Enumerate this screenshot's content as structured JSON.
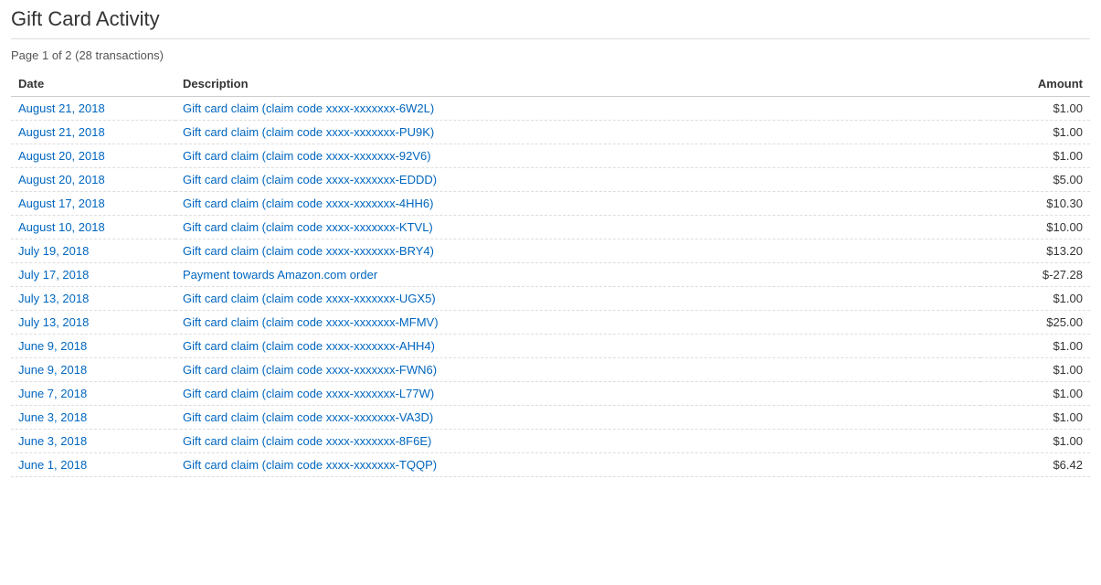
{
  "page": {
    "title": "Gift Card Activity",
    "pagination": "Page 1 of 2 (28 transactions)"
  },
  "table": {
    "headers": {
      "date": "Date",
      "description": "Description",
      "amount": "Amount"
    },
    "rows": [
      {
        "date": "August 21, 2018",
        "description": "Gift card claim (claim code xxxx-xxxxxxx-6W2L)",
        "amount": "$1.00"
      },
      {
        "date": "August 21, 2018",
        "description": "Gift card claim (claim code xxxx-xxxxxxx-PU9K)",
        "amount": "$1.00"
      },
      {
        "date": "August 20, 2018",
        "description": "Gift card claim (claim code xxxx-xxxxxxx-92V6)",
        "amount": "$1.00"
      },
      {
        "date": "August 20, 2018",
        "description": "Gift card claim (claim code xxxx-xxxxxxx-EDDD)",
        "amount": "$5.00"
      },
      {
        "date": "August 17, 2018",
        "description": "Gift card claim (claim code xxxx-xxxxxxx-4HH6)",
        "amount": "$10.30"
      },
      {
        "date": "August 10, 2018",
        "description": "Gift card claim (claim code xxxx-xxxxxxx-KTVL)",
        "amount": "$10.00"
      },
      {
        "date": "July 19, 2018",
        "description": "Gift card claim (claim code xxxx-xxxxxxx-BRY4)",
        "amount": "$13.20"
      },
      {
        "date": "July 17, 2018",
        "description": "Payment towards Amazon.com order",
        "amount": "$-27.28"
      },
      {
        "date": "July 13, 2018",
        "description": "Gift card claim (claim code xxxx-xxxxxxx-UGX5)",
        "amount": "$1.00"
      },
      {
        "date": "July 13, 2018",
        "description": "Gift card claim (claim code xxxx-xxxxxxx-MFMV)",
        "amount": "$25.00"
      },
      {
        "date": "June 9, 2018",
        "description": "Gift card claim (claim code xxxx-xxxxxxx-AHH4)",
        "amount": "$1.00"
      },
      {
        "date": "June 9, 2018",
        "description": "Gift card claim (claim code xxxx-xxxxxxx-FWN6)",
        "amount": "$1.00"
      },
      {
        "date": "June 7, 2018",
        "description": "Gift card claim (claim code xxxx-xxxxxxx-L77W)",
        "amount": "$1.00"
      },
      {
        "date": "June 3, 2018",
        "description": "Gift card claim (claim code xxxx-xxxxxxx-VA3D)",
        "amount": "$1.00"
      },
      {
        "date": "June 3, 2018",
        "description": "Gift card claim (claim code xxxx-xxxxxxx-8F6E)",
        "amount": "$1.00"
      },
      {
        "date": "June 1, 2018",
        "description": "Gift card claim (claim code xxxx-xxxxxxx-TQQP)",
        "amount": "$6.42"
      }
    ]
  }
}
